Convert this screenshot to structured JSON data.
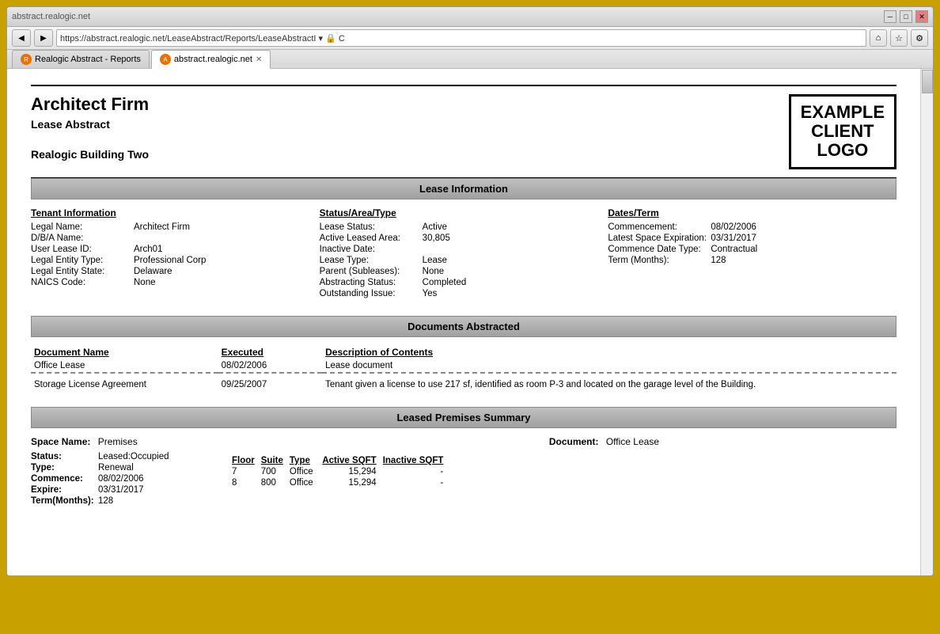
{
  "browser": {
    "title_btn_min": "─",
    "title_btn_max": "□",
    "title_btn_close": "✕",
    "address": "https://abstract.realogic.net/LeaseAbstract/Reports/LeaseAbstractI ▾ 🔒 C",
    "tab1_label": "Realogic Abstract - Reports",
    "tab2_label": "abstract.realogic.net",
    "nav_back": "◀",
    "nav_forward": "▶",
    "nav_home": "⌂",
    "nav_star": "☆",
    "nav_gear": "⚙"
  },
  "report": {
    "firm_name": "Architect Firm",
    "report_type": "Lease Abstract",
    "building": "Realogic Building Two",
    "logo_line1": "EXAMPLE",
    "logo_line2": "CLIENT",
    "logo_line3": "LOGO",
    "sections": {
      "lease_info": {
        "header": "Lease Information",
        "tenant": {
          "title": "Tenant Information",
          "fields": [
            {
              "label": "Legal Name:",
              "value": "Architect Firm"
            },
            {
              "label": "D/B/A Name:",
              "value": ""
            },
            {
              "label": "User Lease ID:",
              "value": "Arch01"
            },
            {
              "label": "Legal Entity Type:",
              "value": "Professional Corp"
            },
            {
              "label": "Legal Entity State:",
              "value": "Delaware"
            },
            {
              "label": "NAICS Code:",
              "value": "None"
            }
          ]
        },
        "status": {
          "title": "Status/Area/Type",
          "fields": [
            {
              "label": "Lease Status:",
              "value": "Active"
            },
            {
              "label": "Active Leased Area:",
              "value": "30,805"
            },
            {
              "label": "Inactive Date:",
              "value": ""
            },
            {
              "label": "Lease Type:",
              "value": "Lease"
            },
            {
              "label": "Parent (Subleases):",
              "value": "None"
            },
            {
              "label": "Abstracting Status:",
              "value": "Completed"
            },
            {
              "label": "Outstanding Issue:",
              "value": "Yes"
            }
          ]
        },
        "dates": {
          "title": "Dates/Term",
          "fields": [
            {
              "label": "Commencement:",
              "value": "08/02/2006"
            },
            {
              "label": "Latest Space Expiration:",
              "value": "03/31/2017"
            },
            {
              "label": "Commence Date Type:",
              "value": "Contractual"
            },
            {
              "label": "Term (Months):",
              "value": "128"
            }
          ]
        }
      },
      "documents": {
        "header": "Documents Abstracted",
        "col_name": "Document Name",
        "col_executed": "Executed",
        "col_desc": "Description of Contents",
        "rows": [
          {
            "name": "Office Lease",
            "executed": "08/02/2006",
            "description": "Lease document"
          },
          {
            "name": "Storage License Agreement",
            "executed": "09/25/2007",
            "description": "Tenant given a license to use 217 sf, identified as room P-3 and located on the garage level of the Building."
          }
        ]
      },
      "premises": {
        "header": "Leased Premises Summary",
        "space_label": "Space Name:",
        "space_value": "Premises",
        "document_label": "Document:",
        "document_value": "Office Lease",
        "status_label": "Status:",
        "status_value": "Leased:Occupied",
        "type_label": "Type:",
        "type_value": "Renewal",
        "commence_label": "Commence:",
        "commence_value": "08/02/2006",
        "expire_label": "Expire:",
        "expire_value": "03/31/2017",
        "term_label": "Term(Months):",
        "term_value": "128",
        "table_cols": [
          "Floor",
          "Suite",
          "Type",
          "Active SQFT",
          "Inactive SQFT"
        ],
        "table_rows": [
          {
            "floor": "7",
            "suite": "700",
            "type": "Office",
            "active_sqft": "15,294",
            "inactive_sqft": "-"
          },
          {
            "floor": "8",
            "suite": "800",
            "type": "Office",
            "active_sqft": "15,294",
            "inactive_sqft": "-"
          }
        ]
      }
    }
  }
}
